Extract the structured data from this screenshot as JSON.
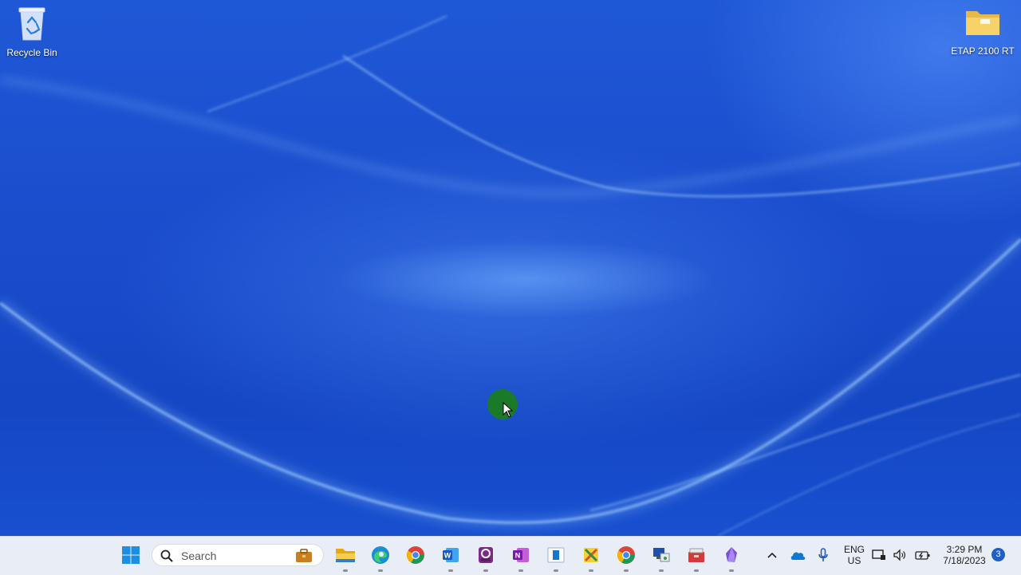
{
  "desktop": {
    "icons": [
      {
        "label": "Recycle Bin",
        "icon": "recycle-bin-icon"
      },
      {
        "label": "ETAP 2100 RT",
        "icon": "folder-icon"
      }
    ]
  },
  "taskbar": {
    "search_placeholder": "Search",
    "apps": [
      {
        "name": "start",
        "icon": "windows-start-icon"
      },
      {
        "name": "work",
        "icon": "briefcase-icon"
      },
      {
        "name": "file-explorer",
        "icon": "file-explorer-icon"
      },
      {
        "name": "edge",
        "icon": "edge-browser-icon"
      },
      {
        "name": "chrome",
        "icon": "chrome-icon"
      },
      {
        "name": "word",
        "icon": "word-icon"
      },
      {
        "name": "pdf",
        "icon": "pdf-editor-icon"
      },
      {
        "name": "onenote",
        "icon": "onenote-icon"
      },
      {
        "name": "app-blue",
        "icon": "blue-app-icon"
      },
      {
        "name": "tools",
        "icon": "tools-icon"
      },
      {
        "name": "chrome-2",
        "icon": "chrome-icon"
      },
      {
        "name": "remote",
        "icon": "remote-desktop-icon"
      },
      {
        "name": "toolbox",
        "icon": "toolbox-icon"
      },
      {
        "name": "obsidian",
        "icon": "purple-crystal-icon"
      }
    ],
    "tray": {
      "lang_top": "ENG",
      "lang_bottom": "US",
      "time": "3:29 PM",
      "date": "7/18/2023",
      "notification_count": "3"
    }
  },
  "colors": {
    "wallpaper": "#1a4fd0",
    "taskbar": "#e9eef6",
    "click_highlight": "#1b7a2a"
  }
}
